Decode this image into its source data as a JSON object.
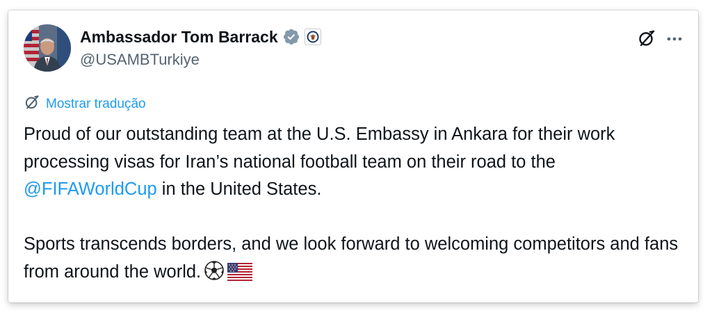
{
  "post": {
    "author": {
      "name": "Ambassador Tom Barrack",
      "handle": "@USAMBTurkiye",
      "avatar_icon": "profile-photo",
      "verified_color": "#829aab"
    },
    "actions": {
      "grok_icon": "grok-icon",
      "more_icon": "more-horizontal-icon"
    },
    "translate": {
      "label": "Mostrar tradução",
      "icon": "grok-icon"
    },
    "text": {
      "p1_part1": "Proud of our outstanding team at the U.S. Embassy in Ankara for their work processing visas for Iran’s national football team on their road to the ",
      "mention": "@FIFAWorldCup",
      "p1_part2": " in the United States.",
      "p2": "Sports transcends borders, and we look forward to welcoming competitors and fans from around the world.",
      "emojis": [
        "soccer-ball-emoji",
        "us-flag-emoji"
      ]
    },
    "colors": {
      "link": "#1d9bf0",
      "text": "#0f1419",
      "secondary": "#536471"
    }
  }
}
